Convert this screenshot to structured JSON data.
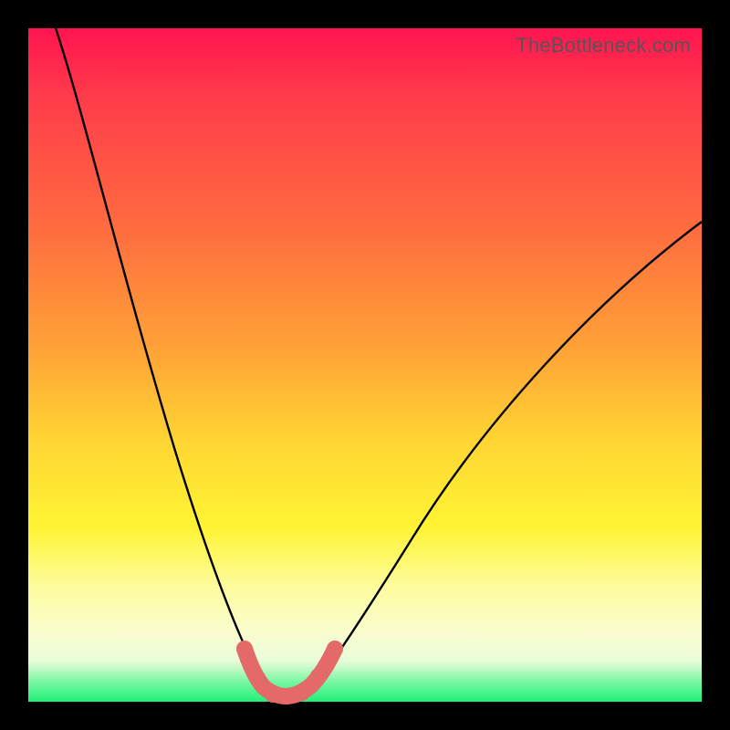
{
  "watermark": "TheBottleneck.com",
  "colors": {
    "background": "#000000",
    "gradient_top": "#ff1450",
    "gradient_mid1": "#ff6d3f",
    "gradient_mid2": "#ffd733",
    "gradient_mid3": "#fdfc9e",
    "gradient_bottom": "#1ef077",
    "curve_stroke": "#000000",
    "highlight_stroke": "#e46a6a",
    "watermark_text": "#565656"
  },
  "chart_data": {
    "type": "line",
    "title": "",
    "xlabel": "",
    "ylabel": "",
    "xlim": [
      0,
      100
    ],
    "ylim": [
      0,
      100
    ],
    "series": [
      {
        "name": "bottleneck-curve",
        "x": [
          4,
          8,
          12,
          16,
          20,
          24,
          27,
          29,
          31,
          33,
          35,
          37,
          39,
          42,
          46,
          50,
          55,
          62,
          70,
          80,
          90,
          100
        ],
        "y": [
          100,
          82,
          66,
          52,
          40,
          29,
          20,
          14,
          9,
          5,
          2,
          1,
          1,
          2,
          5,
          9,
          15,
          23,
          33,
          45,
          57,
          69
        ]
      }
    ],
    "annotations": [
      {
        "name": "trough-highlight",
        "x": [
          30,
          31.5,
          33,
          34.5,
          36,
          37.5,
          39,
          40.5,
          42,
          43.5,
          45
        ],
        "y": [
          9,
          5.5,
          3.2,
          2.0,
          1.3,
          1.0,
          1.3,
          2.0,
          3.2,
          5.5,
          9
        ]
      }
    ]
  }
}
